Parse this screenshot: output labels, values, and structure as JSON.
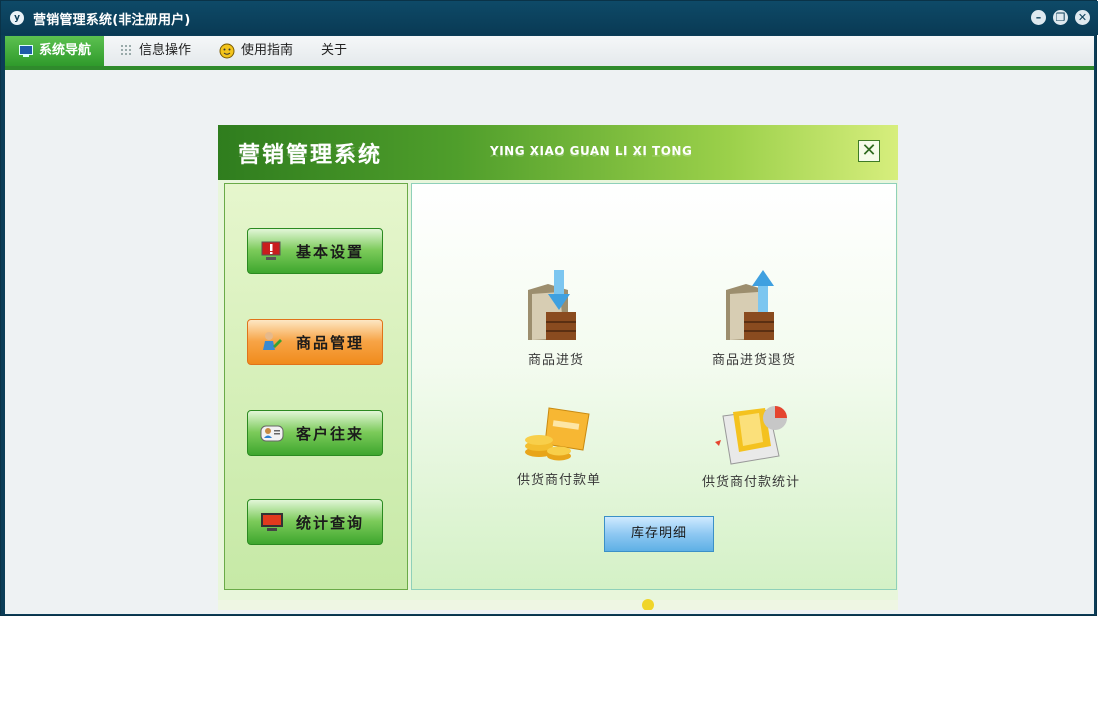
{
  "window": {
    "title": "营销管理系统(非注册用户)",
    "app_icon": "app-logo-icon",
    "controls": [
      "minimize-icon",
      "restore-icon",
      "close-icon"
    ]
  },
  "menubar": {
    "items": [
      {
        "label": "系统导航",
        "icon": "monitor-icon",
        "active": true
      },
      {
        "label": "信息操作",
        "icon": "grid-icon",
        "active": false
      },
      {
        "label": "使用指南",
        "icon": "smiley-icon",
        "active": false
      },
      {
        "label": "关于",
        "icon": "",
        "active": false
      }
    ]
  },
  "panel": {
    "title": "营销管理系统",
    "subtitle": "YING XIAO GUAN LI XI TONG",
    "nav": [
      {
        "label": "基本设置",
        "icon": "warning-monitor-icon",
        "active": false
      },
      {
        "label": "商品管理",
        "icon": "goods-icon",
        "active": true
      },
      {
        "label": "客户往来",
        "icon": "contacts-icon",
        "active": false
      },
      {
        "label": "统计查询",
        "icon": "monitor-icon",
        "active": false
      }
    ],
    "functions": [
      {
        "label": "商品进货",
        "icon": "folder-box-down-icon"
      },
      {
        "label": "商品进货退货",
        "icon": "folder-box-up-icon"
      },
      {
        "label": "供货商付款单",
        "icon": "coins-card-icon"
      },
      {
        "label": "供货商付款统计",
        "icon": "folder-chart-icon"
      }
    ],
    "stock_button": "库存明细"
  },
  "colors": {
    "titlebar": "#0b3d57",
    "menu_active": "#3aa232",
    "nav_green": "#3ea62e",
    "nav_orange": "#f08b1c",
    "stock_blue": "#5eb0e5"
  }
}
